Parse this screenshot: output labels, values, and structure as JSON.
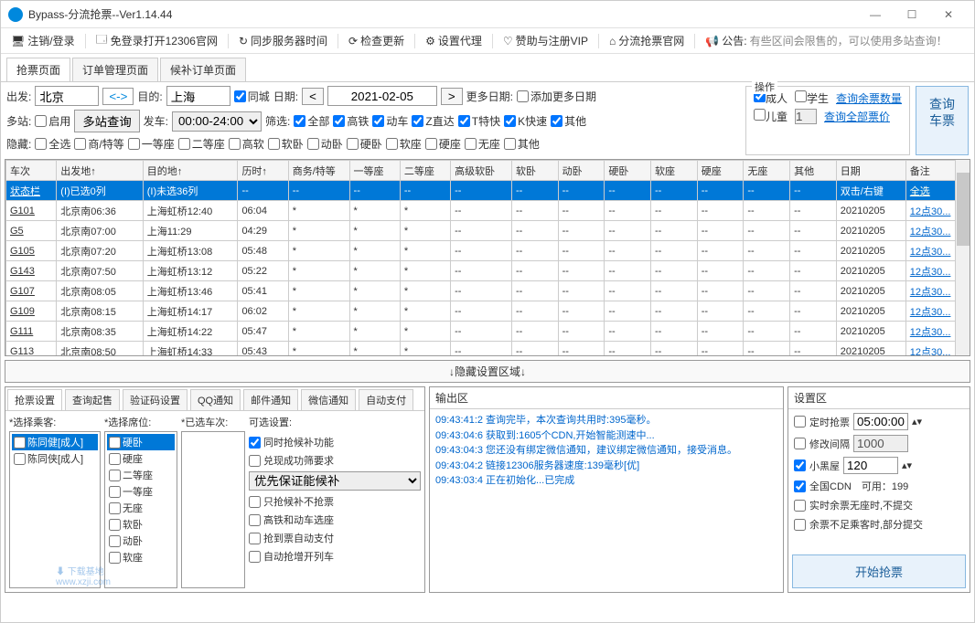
{
  "window": {
    "title": "Bypass-分流抢票--Ver1.14.44"
  },
  "toolbar": {
    "logout": "注销/登录",
    "openOfficial": "免登录打开12306官网",
    "syncTime": "同步服务器时间",
    "checkUpdate": "检查更新",
    "setProxy": "设置代理",
    "sponsor": "赞助与注册VIP",
    "official": "分流抢票官网",
    "announceLabel": "公告:",
    "announceText": "有些区间会限售的，可以使用多站查询！"
  },
  "mainTabs": [
    "抢票页面",
    "订单管理页面",
    "候补订单页面"
  ],
  "search": {
    "fromLabel": "出发:",
    "from": "北京",
    "toLabel": "目的:",
    "to": "上海",
    "sameCity": "同城",
    "dateLabel": "日期:",
    "date": "2021-02-05",
    "moreDateLabel": "更多日期:",
    "addMoreDate": "添加更多日期",
    "multiLabel": "多站:",
    "enable": "启用",
    "multiQuery": "多站查询",
    "departLabel": "发车:",
    "departTime": "00:00-24:00",
    "filterLabel": "筛选:",
    "filters": [
      "全部",
      "高铁",
      "动车",
      "Z直达",
      "T特快",
      "K快速",
      "其他"
    ],
    "hideLabel": "隐藏:",
    "hideAll": "全选",
    "hideOpts": [
      "商/特等",
      "一等座",
      "二等座",
      "高软",
      "软卧",
      "动卧",
      "硬卧",
      "软座",
      "硬座",
      "无座",
      "其他"
    ]
  },
  "op": {
    "title": "操作",
    "adult": "成人",
    "student": "学生",
    "child": "儿童",
    "childNum": "1",
    "queryRemain": "查询余票数量",
    "queryPrice": "查询全部票价",
    "queryBtn": "查询\n车票"
  },
  "table": {
    "headers": [
      "车次",
      "出发地↑",
      "目的地↑",
      "历时↑",
      "商务/特等",
      "一等座",
      "二等座",
      "高级软卧",
      "软卧",
      "动卧",
      "硬卧",
      "软座",
      "硬座",
      "无座",
      "其他",
      "日期",
      "备注"
    ],
    "statusRow": [
      "状态栏",
      "(I)已选0列",
      "(I)未选36列",
      "--",
      "--",
      "--",
      "--",
      "--",
      "--",
      "--",
      "--",
      "--",
      "--",
      "--",
      "--",
      "双击/右键",
      "全选"
    ],
    "rows": [
      {
        "train": "G101",
        "dep": "北京南06:36",
        "arr": "上海虹桥12:40",
        "dur": "06:04",
        "cols": [
          "*",
          "*",
          "*",
          "--",
          "--",
          "--",
          "--",
          "--",
          "--",
          "--",
          "--"
        ],
        "date": "20210205",
        "note": "12点30..."
      },
      {
        "train": "G5",
        "dep": "北京南07:00",
        "arr": "上海11:29",
        "dur": "04:29",
        "cols": [
          "*",
          "*",
          "*",
          "--",
          "--",
          "--",
          "--",
          "--",
          "--",
          "--",
          "--"
        ],
        "date": "20210205",
        "note": "12点30..."
      },
      {
        "train": "G105",
        "dep": "北京南07:20",
        "arr": "上海虹桥13:08",
        "dur": "05:48",
        "cols": [
          "*",
          "*",
          "*",
          "--",
          "--",
          "--",
          "--",
          "--",
          "--",
          "--",
          "--"
        ],
        "date": "20210205",
        "note": "12点30..."
      },
      {
        "train": "G143",
        "dep": "北京南07:50",
        "arr": "上海虹桥13:12",
        "dur": "05:22",
        "cols": [
          "*",
          "*",
          "*",
          "--",
          "--",
          "--",
          "--",
          "--",
          "--",
          "--",
          "--"
        ],
        "date": "20210205",
        "note": "12点30..."
      },
      {
        "train": "G107",
        "dep": "北京南08:05",
        "arr": "上海虹桥13:46",
        "dur": "05:41",
        "cols": [
          "*",
          "*",
          "*",
          "--",
          "--",
          "--",
          "--",
          "--",
          "--",
          "--",
          "--"
        ],
        "date": "20210205",
        "note": "12点30..."
      },
      {
        "train": "G109",
        "dep": "北京南08:15",
        "arr": "上海虹桥14:17",
        "dur": "06:02",
        "cols": [
          "*",
          "*",
          "*",
          "--",
          "--",
          "--",
          "--",
          "--",
          "--",
          "--",
          "--"
        ],
        "date": "20210205",
        "note": "12点30..."
      },
      {
        "train": "G111",
        "dep": "北京南08:35",
        "arr": "上海虹桥14:22",
        "dur": "05:47",
        "cols": [
          "*",
          "*",
          "*",
          "--",
          "--",
          "--",
          "--",
          "--",
          "--",
          "--",
          "--"
        ],
        "date": "20210205",
        "note": "12点30..."
      },
      {
        "train": "G113",
        "dep": "北京南08:50",
        "arr": "上海虹桥14:33",
        "dur": "05:43",
        "cols": [
          "*",
          "*",
          "*",
          "--",
          "--",
          "--",
          "--",
          "--",
          "--",
          "--",
          "--"
        ],
        "date": "20210205",
        "note": "12点30..."
      }
    ]
  },
  "hiddenBar": "↓隐藏设置区域↓",
  "subTabs": [
    "抢票设置",
    "查询起售",
    "验证码设置",
    "QQ通知",
    "邮件通知",
    "微信通知",
    "自动支付"
  ],
  "grab": {
    "passLabel": "*选择乘客:",
    "passengers": [
      "陈同健[成人]",
      "陈同侠[成人]"
    ],
    "seatLabel": "*选择席位:",
    "seats": [
      "硬卧",
      "硬座",
      "二等座",
      "一等座",
      "无座",
      "软卧",
      "动卧",
      "软座"
    ],
    "trainLabel": "*已选车次:",
    "optLabel": "可选设置:",
    "opt1": "同时抢候补功能",
    "opt2": "兑现成功筛要求",
    "opt3sel": "优先保证能候补",
    "opt4": "只抢候补不抢票",
    "opt5": "高铁和动车选座",
    "opt6": "抢到票自动支付",
    "opt7": "自动抢增开列车"
  },
  "output": {
    "title": "输出区",
    "lines": [
      "09:43:41:2  查询完毕，本次查询共用时:395毫秒。",
      "09:43:04:6  获取到:1605个CDN,开始智能测速中...",
      "09:43:04:3  您还没有绑定微信通知，建议绑定微信通知，接受消息。",
      "09:43:04:2  链接12306服务器速度:139毫秒[优]",
      "09:43:03:4  正在初始化...已完成"
    ]
  },
  "settings": {
    "title": "设置区",
    "timed": "定时抢票",
    "timedVal": "05:00:00",
    "interval": "修改间隔",
    "intervalVal": "1000",
    "blackroom": "小黑屋",
    "blackroomVal": "120",
    "cdn": "全国CDN",
    "cdnInfo": "可用：199",
    "noSeat": "实时余票无座时,不提交",
    "notEnough": "余票不足乘客时,部分提交",
    "startBtn": "开始抢票"
  },
  "watermark": "下载基地\nwww.xzji.com"
}
